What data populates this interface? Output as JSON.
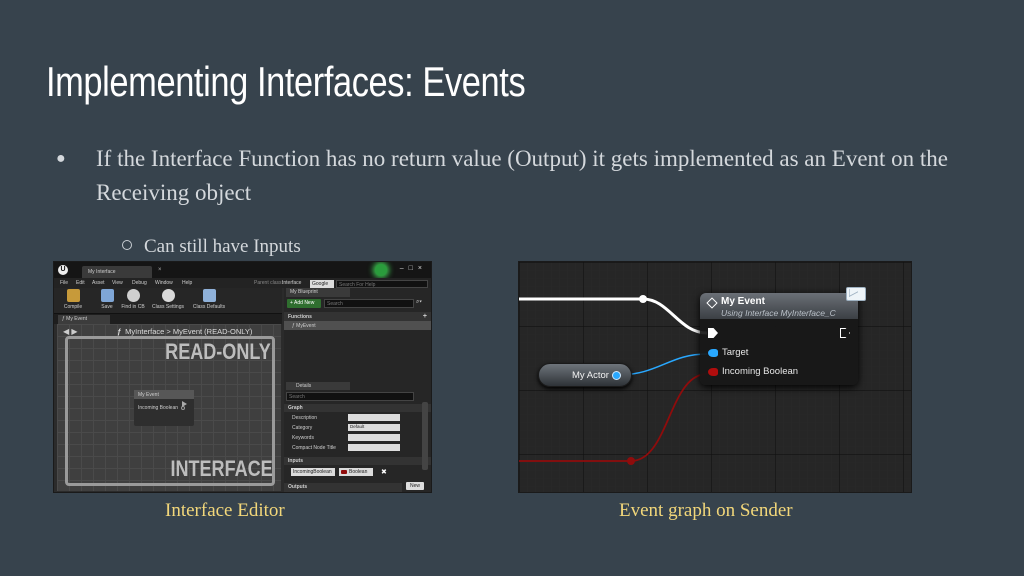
{
  "slide": {
    "title": "Implementing Interfaces: Events",
    "bullet": "If the Interface Function has no return value (Output) it gets implemented as an Event on the Receiving object",
    "sub_bullet": "Can still have Inputs",
    "caption_left": "Interface Editor",
    "caption_right": "Event graph on Sender"
  },
  "editor": {
    "tab_title": "My Interface",
    "menu": [
      "File",
      "Edit",
      "Asset",
      "View",
      "Debug",
      "Window",
      "Help"
    ],
    "parent_class": "Parent class:",
    "interface_label": "Interface",
    "google_label": "Google",
    "search_help_placeholder": "Search For Help",
    "toolbar": [
      "Compile",
      "Save",
      "Find in CB",
      "Class Settings",
      "Class Defaults"
    ],
    "graph_tab": "My Event",
    "breadcrumb": "MyInterface  >  MyEvent  (READ-ONLY)",
    "watermark_top": "READ-ONLY",
    "watermark_bottom": "INTERFACE",
    "mini_node_title": "My Event",
    "mini_node_pin": "Incoming Boolean",
    "my_blueprint_tab": "My Blueprint",
    "add_new": "+ Add New",
    "search_placeholder": "Search",
    "functions_header": "Functions",
    "function_item": "MyEvent",
    "details_tab": "Details",
    "graph_section": "Graph",
    "props": [
      {
        "label": "Description",
        "value": ""
      },
      {
        "label": "Category",
        "value": "Default"
      },
      {
        "label": "Keywords",
        "value": ""
      },
      {
        "label": "Compact Node Title",
        "value": ""
      }
    ],
    "inputs_section": "Inputs",
    "input_name": "IncomingBoolean",
    "input_type": "Boolean",
    "new_button": "New",
    "outputs_section": "Outputs"
  },
  "event_graph": {
    "node_title": "My Event",
    "node_subtitle": "Using Interface MyInterface_C",
    "pin_target": "Target",
    "pin_boolean": "Incoming Boolean",
    "actor_node": "My Actor",
    "colors": {
      "object_pin": "#29a8ff",
      "bool_pin": "#b00d0d",
      "exec_wire": "#ffffff"
    }
  }
}
